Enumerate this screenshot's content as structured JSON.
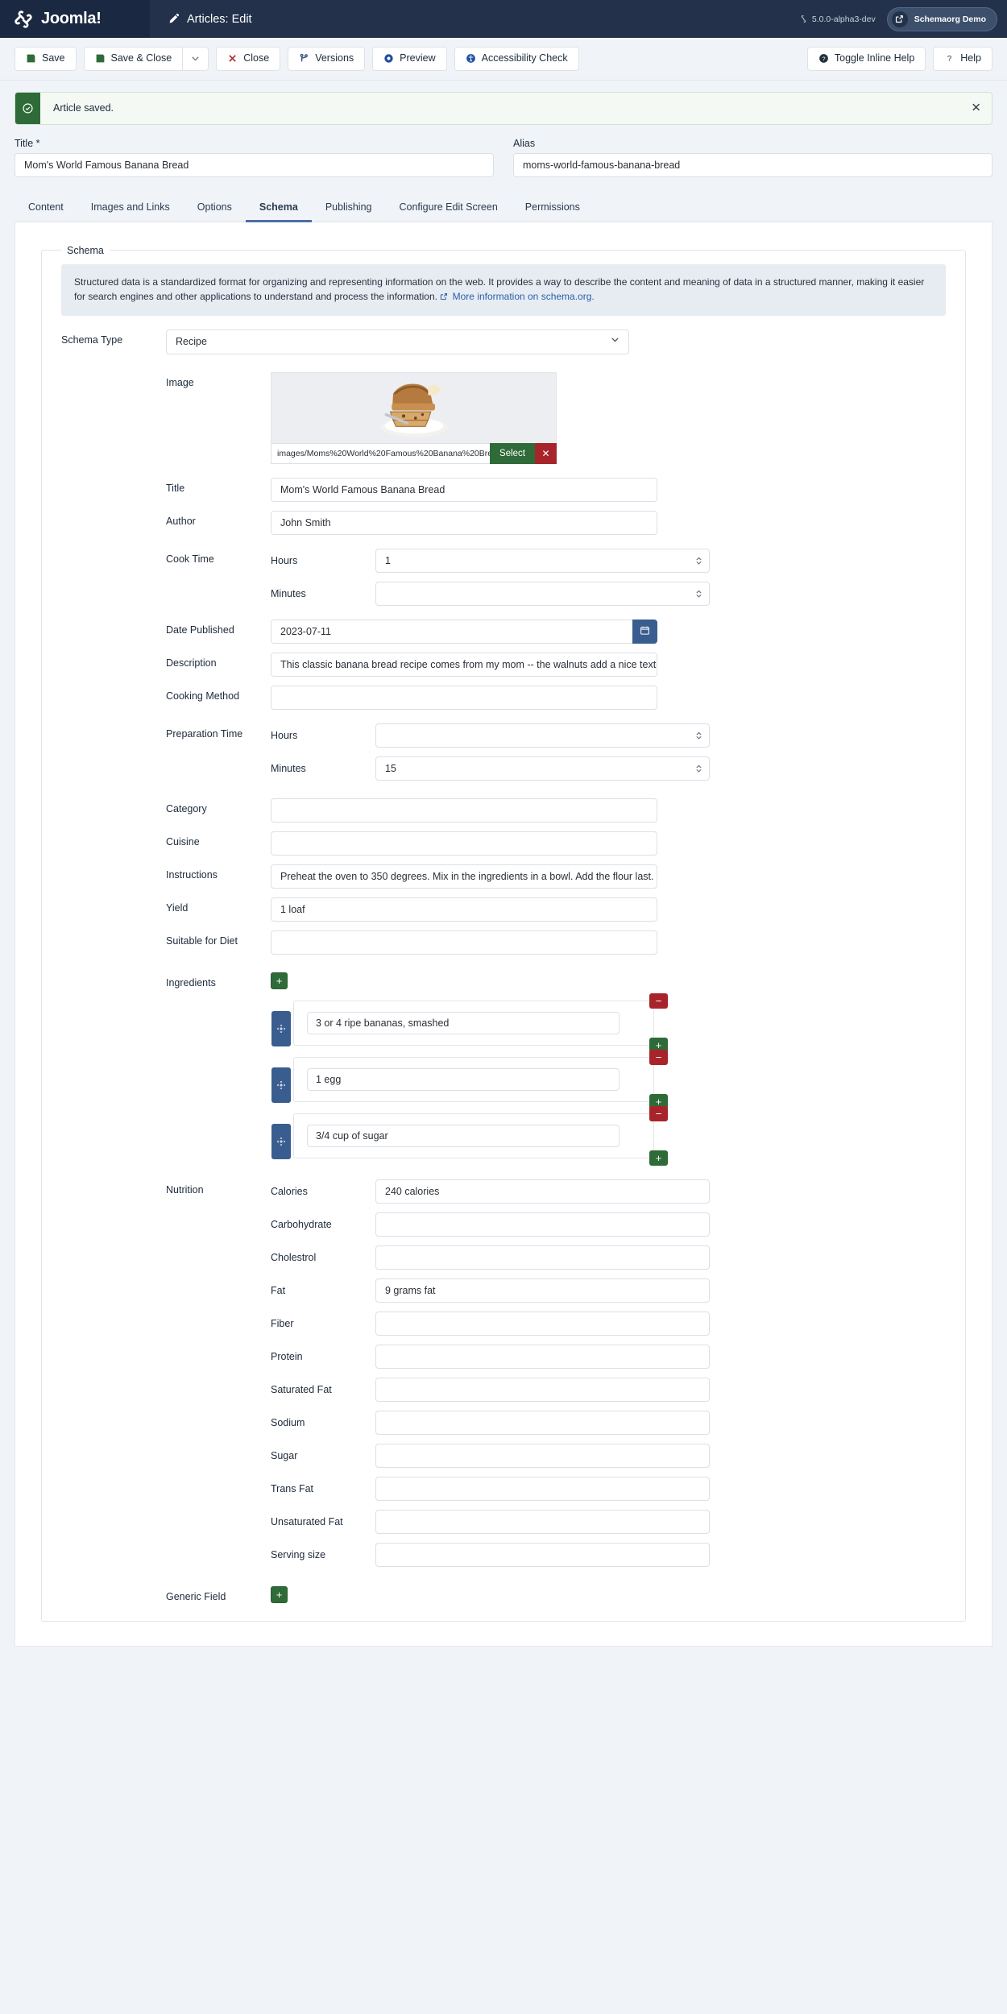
{
  "header": {
    "brand": "Joomla!",
    "page_title": "Articles: Edit",
    "version": "5.0.0-alpha3-dev",
    "site_button": "Schemaorg Demo"
  },
  "toolbar": {
    "save": "Save",
    "save_close": "Save & Close",
    "close": "Close",
    "versions": "Versions",
    "preview": "Preview",
    "accessibility_check": "Accessibility Check",
    "toggle_inline_help": "Toggle Inline Help",
    "help": "Help"
  },
  "alert": {
    "message": "Article saved.",
    "close": "✕"
  },
  "fields": {
    "title_label": "Title *",
    "title_value": "Mom's World Famous Banana Bread",
    "alias_label": "Alias",
    "alias_value": "moms-world-famous-banana-bread"
  },
  "tabs": [
    {
      "label": "Content",
      "active": false
    },
    {
      "label": "Images and Links",
      "active": false
    },
    {
      "label": "Options",
      "active": false
    },
    {
      "label": "Schema",
      "active": true
    },
    {
      "label": "Publishing",
      "active": false
    },
    {
      "label": "Configure Edit Screen",
      "active": false
    },
    {
      "label": "Permissions",
      "active": false
    }
  ],
  "schema": {
    "legend": "Schema",
    "info_text": "Structured data is a standardized format for organizing and representing information on the web. It provides a way to describe the content and meaning of data in a structured manner, making it easier for search engines and other applications to understand and process the information.",
    "info_link": "More information on schema.org.",
    "type_label": "Schema Type",
    "type_value": "Recipe",
    "image_label": "Image",
    "image_path": "images/Moms%20World%20Famous%20Banana%20Bread.jpeg#joor",
    "image_select": "Select",
    "image_clear": "✕",
    "recipe_title_label": "Title",
    "recipe_title_value": "Mom's World Famous Banana Bread",
    "author_label": "Author",
    "author_value": "John Smith",
    "cook_time_label": "Cook Time",
    "cook_hours_label": "Hours",
    "cook_hours_value": "1",
    "cook_minutes_label": "Minutes",
    "cook_minutes_value": "",
    "date_published_label": "Date Published",
    "date_published_value": "2023-07-11",
    "description_label": "Description",
    "description_value": "This classic banana bread recipe comes from my mom -- the walnuts add a nice texture and flavor to the ba",
    "cooking_method_label": "Cooking Method",
    "cooking_method_value": "",
    "prep_time_label": "Preparation Time",
    "prep_hours_label": "Hours",
    "prep_hours_value": "",
    "prep_minutes_label": "Minutes",
    "prep_minutes_value": "15",
    "category_label": "Category",
    "category_value": "",
    "cuisine_label": "Cuisine",
    "cuisine_value": "",
    "instructions_label": "Instructions",
    "instructions_value": "Preheat the oven to 350 degrees. Mix in the ingredients in a bowl. Add the flour last. Pour the mixture into a",
    "yield_label": "Yield",
    "yield_value": "1 loaf",
    "diet_label": "Suitable for Diet",
    "diet_value": "",
    "ingredients_label": "Ingredients",
    "ingredients": [
      {
        "value": "3 or 4 ripe bananas, smashed"
      },
      {
        "value": "1 egg"
      },
      {
        "value": "3/4 cup of sugar"
      }
    ],
    "add_glyph": "+",
    "remove_glyph": "−",
    "nutrition_label": "Nutrition",
    "nutrition": [
      {
        "label": "Calories",
        "value": "240 calories"
      },
      {
        "label": "Carbohydrate",
        "value": ""
      },
      {
        "label": "Cholestrol",
        "value": ""
      },
      {
        "label": "Fat",
        "value": "9 grams fat"
      },
      {
        "label": "Fiber",
        "value": ""
      },
      {
        "label": "Protein",
        "value": ""
      },
      {
        "label": "Saturated Fat",
        "value": ""
      },
      {
        "label": "Sodium",
        "value": ""
      },
      {
        "label": "Sugar",
        "value": ""
      },
      {
        "label": "Trans Fat",
        "value": ""
      },
      {
        "label": "Unsaturated Fat",
        "value": ""
      },
      {
        "label": "Serving size",
        "value": ""
      }
    ],
    "generic_field_label": "Generic Field"
  },
  "colors": {
    "header_bg": "#23314a",
    "brand_bg": "#1b2841",
    "accent_green": "#2f6b38",
    "accent_red": "#a8242b",
    "accent_blue": "#3a5d8f",
    "tab_active": "#4a6fa5",
    "page_bg": "#f0f4f9"
  }
}
